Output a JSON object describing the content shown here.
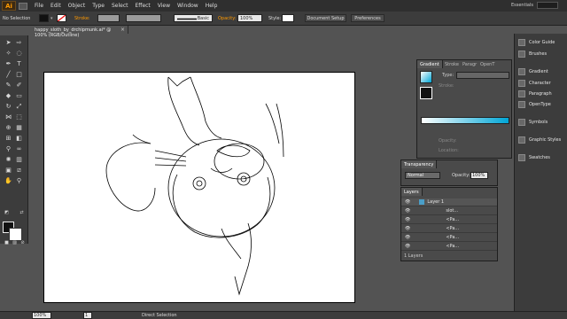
{
  "app": {
    "logo": "Ai"
  },
  "menu": [
    "File",
    "Edit",
    "Object",
    "Type",
    "Select",
    "Effect",
    "View",
    "Window",
    "Help"
  ],
  "workspace": {
    "label": "Essentials"
  },
  "control_bar": {
    "selection": "No Selection",
    "stroke_label": "Stroke:",
    "brush_label": "Basic",
    "opacity_label": "Opacity:",
    "opacity_value": "100%",
    "style_label": "Style:",
    "doc_setup": "Document Setup",
    "preferences": "Preferences"
  },
  "document": {
    "tab_title": "happy_sloth_by_drchipmunk.ai* @ 100% (RGB/Outline)",
    "close": "×"
  },
  "status": {
    "zoom": "100%",
    "page": "1",
    "tool": "Direct Selection"
  },
  "right_panels": [
    {
      "label": "Color Guide",
      "icon": "color-guide-icon"
    },
    {
      "label": "Brushes",
      "icon": "brushes-icon"
    },
    {
      "label": "Gradient",
      "icon": "gradient-icon"
    },
    {
      "label": "Character",
      "icon": "character-icon"
    },
    {
      "label": "Paragraph",
      "icon": "paragraph-icon"
    },
    {
      "label": "OpenType",
      "icon": "opentype-icon"
    },
    {
      "label": "Symbols",
      "icon": "symbols-icon"
    },
    {
      "label": "Graphic Styles",
      "icon": "graphic-styles-icon"
    },
    {
      "label": "Swatches",
      "icon": "swatches-icon"
    }
  ],
  "gradient_panel": {
    "tabs": [
      "Gradient",
      "Stroke",
      "Paragr",
      "OpenT"
    ],
    "type_label": "Type:",
    "stroke_label": "Stroke:",
    "opacity_label": "Opacity:",
    "location_label": "Location:",
    "gradient_from": "#ffffff",
    "gradient_to": "#00a6d6"
  },
  "transparency_panel": {
    "tab": "Transparency",
    "blend_mode": "Normal",
    "opacity_label": "Opacity:",
    "opacity_value": "100%"
  },
  "layers_panel": {
    "tab": "Layers",
    "footer": "1 Layers",
    "layer_name": "Layer 1",
    "rows": [
      "slot...",
      "<Pa...",
      "<Pa...",
      "<Pa...",
      "<Pa..."
    ]
  },
  "colors": {
    "accent": "#00a6d6",
    "fill": "#111111",
    "stroke": "#ffffff"
  }
}
